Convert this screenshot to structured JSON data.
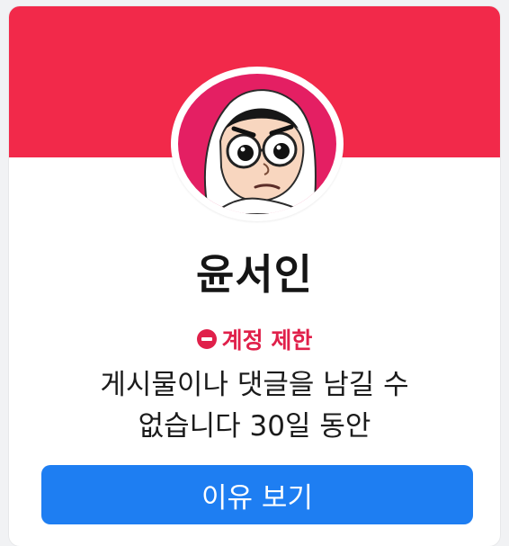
{
  "colors": {
    "banner": "#f2294a",
    "avatar_bg": "#e41f63",
    "restriction": "#e0204a",
    "button": "#1e7ef2"
  },
  "profile": {
    "name": "윤서인"
  },
  "restriction": {
    "icon": "minus-circle-icon",
    "label": "계정 제한",
    "message_line1": "게시물이나 댓글을 남길 수",
    "message_line2": "없습니다 30일 동안"
  },
  "actions": {
    "reason_button": "이유 보기"
  }
}
